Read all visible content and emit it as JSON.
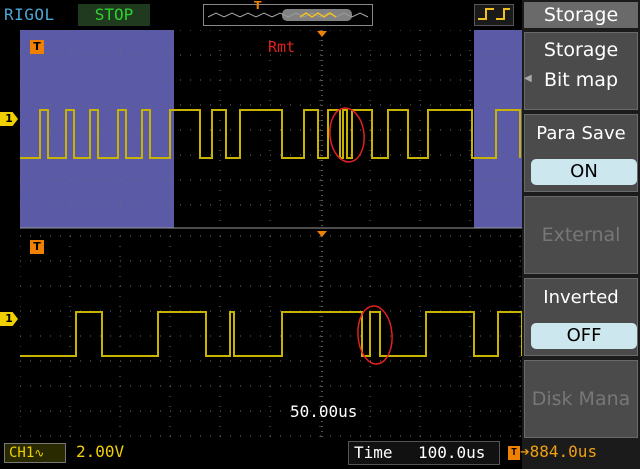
{
  "header": {
    "brand": "RIGOL",
    "run_state": "STOP",
    "trigger_marker": "T"
  },
  "screen": {
    "remote_indicator": "Rmt",
    "zoom_timebase": "50.00us",
    "channel_marker": "1",
    "trigger_marker": "T"
  },
  "menu": {
    "title": "Storage",
    "items": [
      {
        "label": "Storage",
        "value": null,
        "enabled": true
      },
      {
        "label": "Bit map",
        "value": null,
        "enabled": true
      },
      {
        "label": "Para Save",
        "value": "ON",
        "enabled": true
      },
      {
        "label": "External",
        "value": null,
        "enabled": false
      },
      {
        "label": "Inverted",
        "value": "OFF",
        "enabled": true
      },
      {
        "label": "Disk Mana",
        "value": null,
        "enabled": false
      }
    ]
  },
  "footer": {
    "channel_tag": "CH1",
    "coupling_icon": "ac-coupling-icon",
    "channel_scale": "2.00V",
    "time_label": "Time",
    "time_value": "100.0us",
    "trigger_offset": "884.0us"
  },
  "colors": {
    "trace": "#c8b400",
    "grid": "#6e6e6e",
    "zoom_window": "#5a5aa6",
    "annotation": "#e02020",
    "menu_value_bg": "#cde7ef"
  }
}
